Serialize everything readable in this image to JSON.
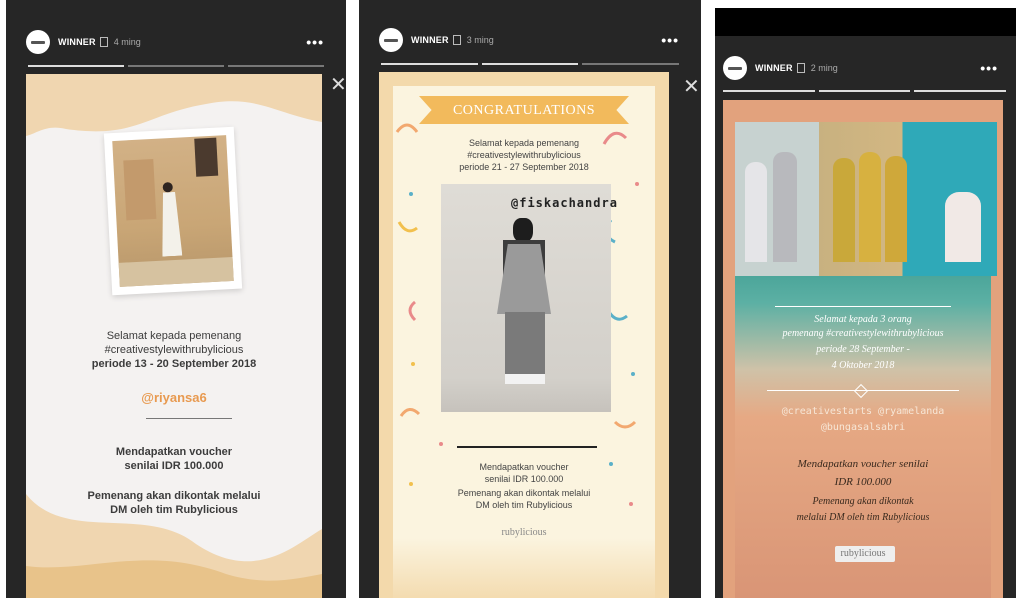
{
  "stories": [
    {
      "username": "WINNER",
      "time": "4 ming",
      "more": "•••",
      "close": "✕",
      "caption": {
        "line1": "Selamat kepada pemenang",
        "line2": "#creativestylewithrubylicious",
        "line3": "periode 13 - 20 September 2018",
        "handle": "@riyansa6",
        "prize1": "Mendapatkan voucher",
        "prize2": "senilai IDR 100.000",
        "contact1": "Pemenang akan dikontak melalui",
        "contact2": "DM oleh tim Rubylicious"
      }
    },
    {
      "username": "WINNER",
      "time": "3 ming",
      "more": "•••",
      "close": "✕",
      "banner": "CONGRATULATIONS",
      "caption": {
        "line1": "Selamat kepada pemenang",
        "line2": "#creativestylewithrubylicious",
        "line3": "periode 21 - 27 September 2018",
        "handle": "@fiskachandra",
        "prize1": "Mendapatkan voucher",
        "prize2": "senilai IDR 100.000",
        "contact1": "Pemenang akan dikontak melalui",
        "contact2": "DM oleh tim Rubylicious",
        "logo": "rubylicious"
      }
    },
    {
      "username": "WINNER",
      "time": "2 ming",
      "more": "•••",
      "caption": {
        "line1": "Selamat kepada 3 orang",
        "line2": "pemenang #creativestylewithrubylicious",
        "line3": "periode 28 September -",
        "line4": "4 Oktober 2018",
        "handles1": "@creativestarts  @ryamelanda",
        "handles2": "@bungasalsabri",
        "prize1": "Mendapatkan voucher senilai",
        "prize2": "IDR 100.000",
        "contact1": "Pemenang akan dikontak",
        "contact2": "melalui DM oleh tim Rubylicious",
        "logo": "rubylicious"
      }
    }
  ],
  "colors": {
    "frame": "#262626",
    "card1": "#f6f3f2",
    "card1_accent": "#f0d6b0",
    "handle1": "#e89a50",
    "card2": "#fbf4df",
    "banner2": "#f2ba5c",
    "card3_top": "#3a9a8f",
    "card3_bottom": "#d99576"
  }
}
